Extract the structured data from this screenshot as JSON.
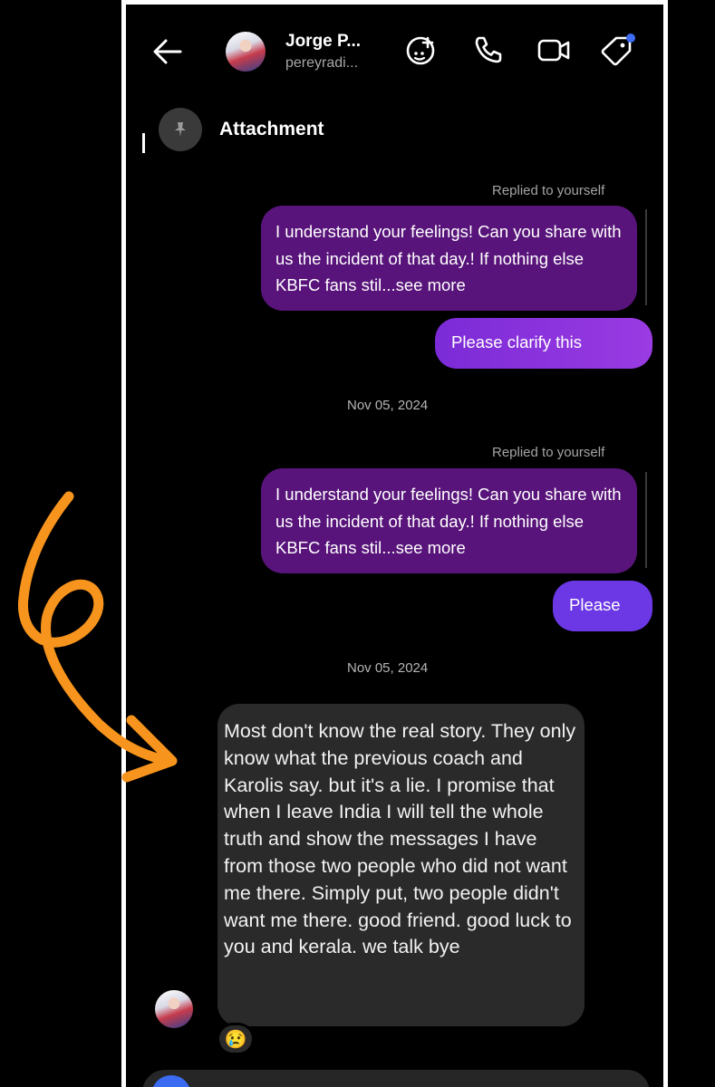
{
  "header": {
    "contact_name": "Jorge P...",
    "contact_handle": "pereyradi..."
  },
  "pinned": {
    "label": "Attachment"
  },
  "messages": [
    {
      "type": "outgoing_reply",
      "meta": "Replied to yourself",
      "text": "I understand your feelings!  Can you share with us the incident of that day.! If nothing else KBFC fans stil...see more"
    },
    {
      "type": "outgoing",
      "text": "Please clarify  this"
    },
    {
      "type": "date",
      "text": "Nov 05, 2024"
    },
    {
      "type": "outgoing_reply",
      "meta": "Replied to yourself",
      "text": "I understand your feelings!  Can you share with us the incident of that day.! If nothing else KBFC fans stil...see more"
    },
    {
      "type": "outgoing",
      "text": "Please"
    },
    {
      "type": "date",
      "text": "Nov 05, 2024"
    },
    {
      "type": "incoming",
      "text": "Most don't know the real story. They only know what the previous coach and Karolis say. but it's a lie. I promise that when I leave India I will tell the whole truth and show the messages I have from those two people who did not want me there. Simply put, two people didn't want me there. good friend. good luck to you and kerala. we talk bye",
      "reaction": "😢"
    }
  ],
  "icons": {
    "back": "arrow-left-icon",
    "effects": "sparkle-face-icon",
    "call": "phone-icon",
    "video": "video-camera-icon",
    "tag": "tag-icon",
    "pin": "pin-icon"
  },
  "colors": {
    "background": "#000000",
    "reply_bubble": "#58147a",
    "outgoing_violet": "#8e35df",
    "outgoing_blue": "#6c38e6",
    "incoming_bubble": "#2a2a2a",
    "annotation": "#f7941d",
    "frame": "#ffffff",
    "notification_dot": "#3d6cf5"
  }
}
